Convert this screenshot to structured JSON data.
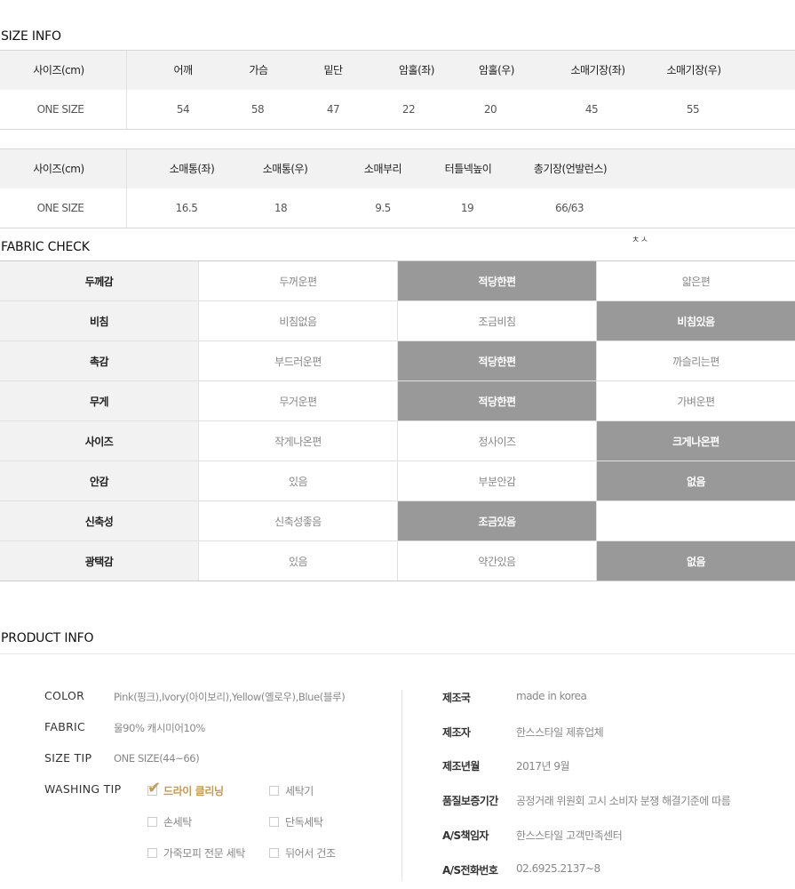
{
  "size_info": {
    "title": "SIZE INFO",
    "table1": {
      "headers": [
        "사이즈(cm)",
        "어깨",
        "가슴",
        "밑단",
        "암홀(좌)",
        "암홀(우)",
        "소매기장(좌)",
        "소매기장(우)"
      ],
      "row": [
        "ONE SIZE",
        "54",
        "58",
        "47",
        "22",
        "20",
        "45",
        "55"
      ]
    },
    "table2": {
      "headers": [
        "사이즈(cm)",
        "소매통(좌)",
        "소매통(우)",
        "소매부리",
        "터틀넥높이",
        "총기장(언발런스)"
      ],
      "row": [
        "ONE SIZE",
        "16.5",
        "18",
        "9.5",
        "19",
        "66/63"
      ]
    }
  },
  "stray_text": "ㅊㅅ",
  "fabric_check": {
    "title": "FABRIC CHECK",
    "rows": [
      {
        "label": "두께감",
        "options": [
          "두꺼운편",
          "적당한편",
          "얇은편"
        ],
        "selected": 1
      },
      {
        "label": "비침",
        "options": [
          "비침없음",
          "조금비침",
          "비침있음"
        ],
        "selected": 2
      },
      {
        "label": "촉감",
        "options": [
          "부드러운편",
          "적당한편",
          "까슬리는편"
        ],
        "selected": 1
      },
      {
        "label": "무게",
        "options": [
          "무거운편",
          "적당한편",
          "가벼운편"
        ],
        "selected": 1
      },
      {
        "label": "사이즈",
        "options": [
          "작게나온편",
          "정사이즈",
          "크게나온편"
        ],
        "selected": 2
      },
      {
        "label": "안감",
        "options": [
          "있음",
          "부분안감",
          "없음"
        ],
        "selected": 2
      },
      {
        "label": "신축성",
        "options": [
          "신축성좋음",
          "조금있음",
          ""
        ],
        "selected": 1
      },
      {
        "label": "광택감",
        "options": [
          "있음",
          "약간있음",
          "없음"
        ],
        "selected": 2
      }
    ]
  },
  "product_info": {
    "title": "PRODUCT INFO",
    "color_label": "COLOR",
    "color_value": "Pink(핑크),Ivory(아이보리),Yellow(옐로우),Blue(블루)",
    "fabric_label": "FABRIC",
    "fabric_value": "울90% 캐시미어10%",
    "size_tip_label": "SIZE TIP",
    "size_tip_value": "ONE SIZE(44~66)",
    "washing_label": "WASHING TIP",
    "washing_options": [
      "드라이 클리닝",
      "세탁기",
      "손세탁",
      "단독세탁",
      "가죽모피 전문 세탁",
      "뒤어서 건조"
    ],
    "washing_checked": 0,
    "details": [
      {
        "label": "제조국",
        "value": "made in korea"
      },
      {
        "label": "제조자",
        "value": "한스스타일 제휴업체"
      },
      {
        "label": "제조년월",
        "value": "2017년 9월"
      },
      {
        "label": "품질보증기간",
        "value": "공정거래 위원회 고시 소비자 분쟁 해결기준에 따름"
      },
      {
        "label": "A/S책임자",
        "value": "한스스타일 고객만족센터"
      },
      {
        "label": "A/S전화번호",
        "value": "02.6925.2137~8"
      }
    ]
  }
}
